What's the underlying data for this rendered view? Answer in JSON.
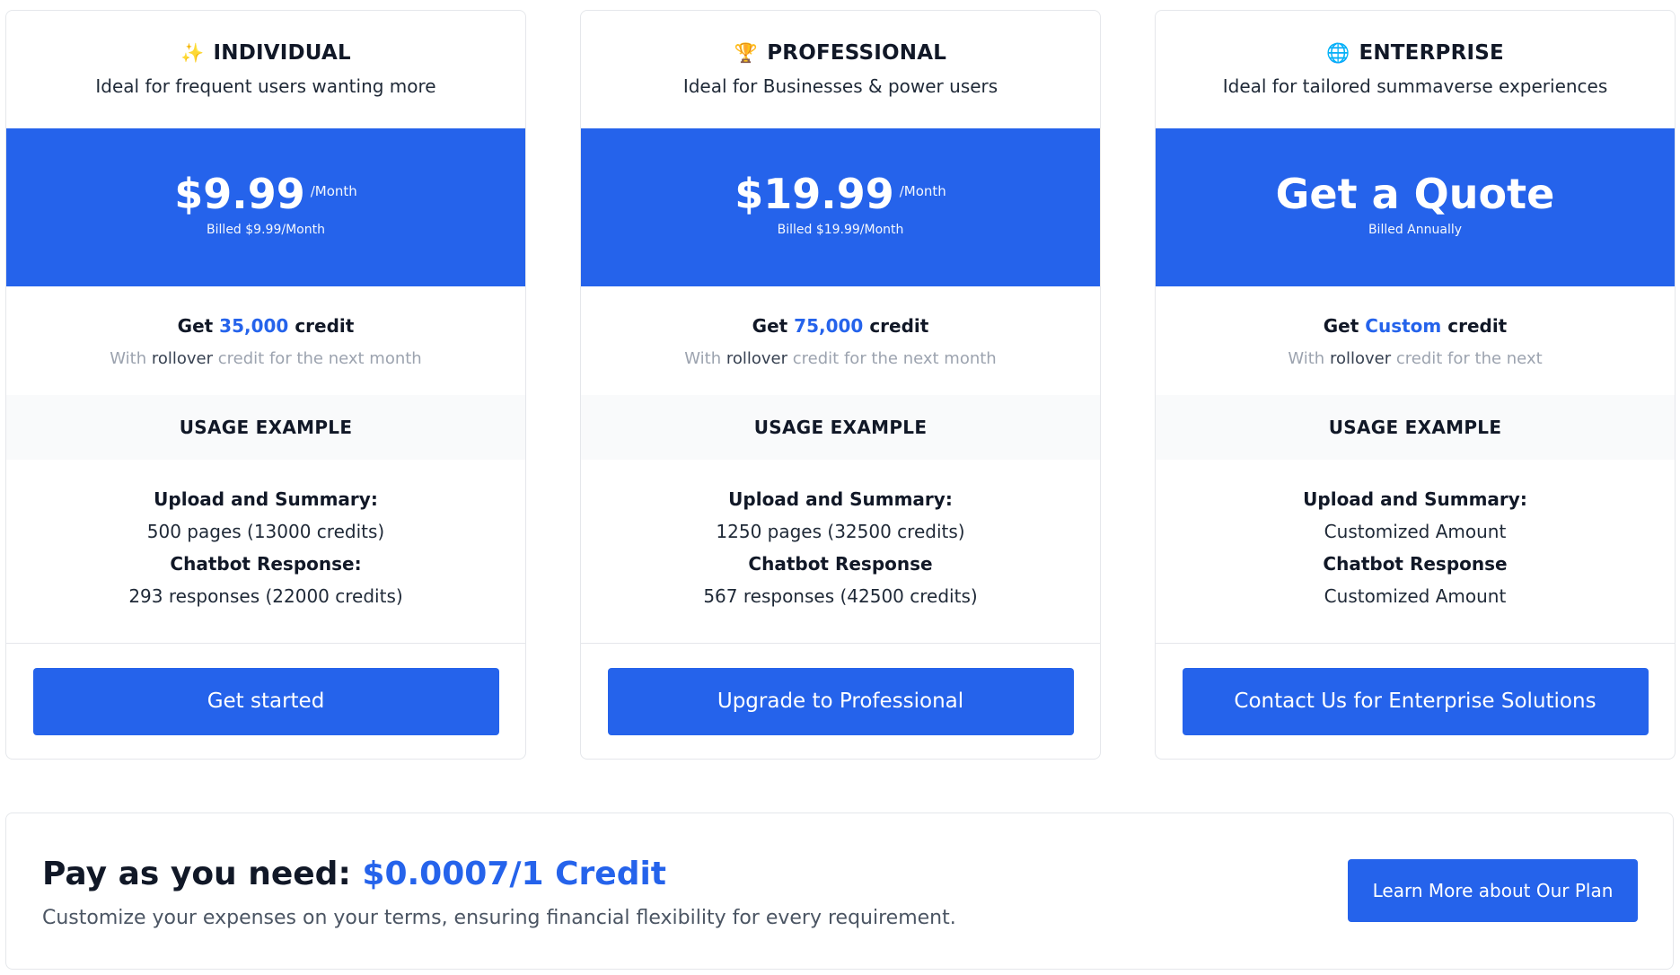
{
  "plans": [
    {
      "icon": "✨",
      "icon_name": "sparkles-icon",
      "name": "INDIVIDUAL",
      "description": "Ideal for frequent users wanting more",
      "price": "$9.99",
      "period": "/Month",
      "billed": "Billed $9.99/Month",
      "credit_prefix": "Get",
      "credit_amount": "35,000",
      "credit_suffix": "credit",
      "rollover_prefix": "With",
      "rollover_word": "rollover",
      "rollover_suffix": "credit for the next month",
      "usage_heading": "USAGE EXAMPLE",
      "upload_label": "Upload and Summary:",
      "upload_value": "500 pages (13000 credits)",
      "chatbot_label": "Chatbot Response:",
      "chatbot_value": "293 responses (22000 credits)",
      "cta": "Get started"
    },
    {
      "icon": "🏆",
      "icon_name": "trophy-icon",
      "name": "PROFESSIONAL",
      "description": "Ideal for Businesses & power users",
      "price": "$19.99",
      "period": "/Month",
      "billed": "Billed $19.99/Month",
      "credit_prefix": "Get",
      "credit_amount": "75,000",
      "credit_suffix": "credit",
      "rollover_prefix": "With",
      "rollover_word": "rollover",
      "rollover_suffix": "credit for the next month",
      "usage_heading": "USAGE EXAMPLE",
      "upload_label": "Upload and Summary:",
      "upload_value": "1250 pages (32500 credits)",
      "chatbot_label": "Chatbot Response",
      "chatbot_value": "567 responses (42500 credits)",
      "cta": "Upgrade to Professional"
    },
    {
      "icon": "🌐",
      "icon_name": "globe-icon",
      "name": "ENTERPRISE",
      "description": "Ideal for tailored summaverse experiences",
      "price": "Get a Quote",
      "period": "",
      "billed": "Billed Annually",
      "credit_prefix": "Get",
      "credit_amount": "Custom",
      "credit_suffix": "credit",
      "rollover_prefix": "With",
      "rollover_word": "rollover",
      "rollover_suffix": "credit for the next",
      "usage_heading": "USAGE EXAMPLE",
      "upload_label": "Upload and Summary:",
      "upload_value": "Customized Amount",
      "chatbot_label": "Chatbot Response",
      "chatbot_value": "Customized Amount",
      "cta": "Contact Us for Enterprise Solutions"
    }
  ],
  "pay_as_you_need": {
    "title_prefix": "Pay as you need:",
    "title_price": "$0.0007/1 Credit",
    "subtitle": "Customize your expenses on your terms, ensuring financial flexibility for every requirement.",
    "button": "Learn More about Our Plan"
  },
  "colors": {
    "accent": "#2563eb",
    "muted": "#9ca3af",
    "band_bg": "#f9fafb"
  }
}
